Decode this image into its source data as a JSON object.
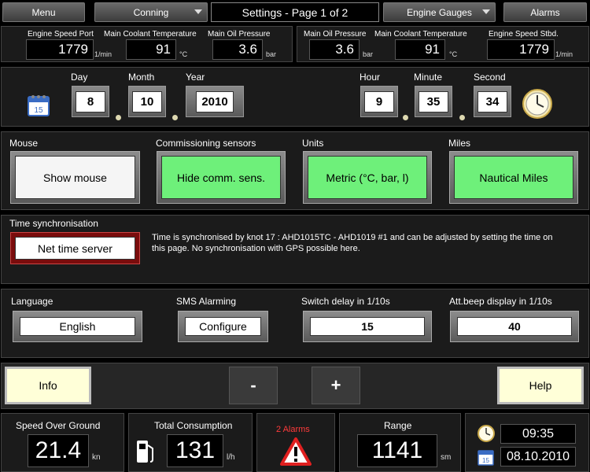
{
  "nav": {
    "menu": "Menu",
    "conning": "Conning",
    "title": "Settings - Page 1 of 2",
    "engine_gauges": "Engine Gauges",
    "alarms": "Alarms"
  },
  "engine_port": {
    "speed_label": "Engine Speed Port",
    "speed": "1779",
    "speed_unit": "1/min",
    "coolant_label": "Main Coolant Temperature",
    "coolant": "91",
    "coolant_unit": "°C",
    "oil_label": "Main Oil Pressure",
    "oil": "3.6",
    "oil_unit": "bar"
  },
  "engine_stbd": {
    "oil_label": "Main Oil Pressure",
    "oil": "3.6",
    "oil_unit": "bar",
    "coolant_label": "Main Coolant Temperature",
    "coolant": "91",
    "coolant_unit": "°C",
    "speed_label": "Engine Speed Stbd.",
    "speed": "1779",
    "speed_unit": "1/min"
  },
  "datetime": {
    "day_label": "Day",
    "day": "8",
    "month_label": "Month",
    "month": "10",
    "year_label": "Year",
    "year": "2010",
    "hour_label": "Hour",
    "hour": "9",
    "minute_label": "Minute",
    "minute": "35",
    "second_label": "Second",
    "second": "34"
  },
  "options": {
    "mouse_label": "Mouse",
    "mouse_btn": "Show mouse",
    "comm_label": "Commissioning sensors",
    "comm_btn": "Hide comm. sens.",
    "units_label": "Units",
    "units_btn": "Metric (°C, bar, l)",
    "miles_label": "Miles",
    "miles_btn": "Nautical Miles"
  },
  "timesync": {
    "label": "Time synchronisation",
    "button": "Net time server",
    "text": "Time is synchronised by knot 17 : AHD1015TC - AHD1019 #1 and can be adjusted by setting the time on this page. No synchronisation with GPS possible here."
  },
  "settings": {
    "language_label": "Language",
    "language": "English",
    "sms_label": "SMS Alarming",
    "sms_btn": "Configure",
    "switch_label": "Switch delay in 1/10s",
    "switch": "15",
    "beep_label": "Att.beep display in 1/10s",
    "beep": "40"
  },
  "bottom": {
    "info": "Info",
    "minus": "-",
    "plus": "+",
    "help": "Help"
  },
  "status": {
    "sog_label": "Speed Over Ground",
    "sog": "21.4",
    "sog_unit": "kn",
    "cons_label": "Total Consumption",
    "cons": "131",
    "cons_unit": "l/h",
    "alarms": "2 Alarms",
    "range_label": "Range",
    "range": "1141",
    "range_unit": "sm",
    "time": "09:35",
    "date": "08.10.2010"
  },
  "colors": {
    "green_button": "#6ef07a",
    "alarm_red": "#ff3b3b",
    "net_time_border": "#7a0c0c",
    "pill_button": "#ffffd8"
  }
}
